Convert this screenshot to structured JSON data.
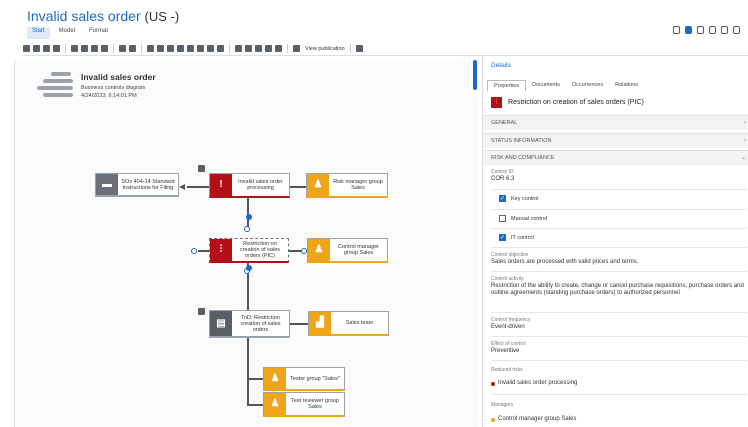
{
  "window": {
    "title": "Invalid sales order",
    "title_suffix": "(US -)",
    "tabs": [
      "Start",
      "Model",
      "Format"
    ]
  },
  "toolbar": {
    "view_publication_label": "View publication"
  },
  "diagram": {
    "header": {
      "title": "Invalid sales order",
      "subtitle": "Business controls diagram",
      "date": "4/24/2023, 6:14:01 PM"
    },
    "nodes": {
      "sox": "SOx 404-14 Standard Instructions for Filing",
      "invalid_order": "Invalid sales order processing",
      "risk_manager": "Risk manager group Sales",
      "restriction": "Restriction on creation of sales orders (PIC)",
      "control_manager": "Control manager group Sales",
      "todo": "ToD: Restriction creation of sales orders",
      "sales_team": "Sales team",
      "tester": "Tester group \"Sales\"",
      "test_reviewer": "Test reviewer group Sales"
    }
  },
  "details": {
    "title": "Details",
    "tabs": [
      "Properties",
      "Documents",
      "Occurrences",
      "Relations"
    ],
    "object_name": "Restriction on creation of sales orders (PIC)",
    "sections": {
      "general": "GENERAL",
      "status": "STATUS INFORMATION",
      "risk": "RISK AND COMPLIANCE"
    },
    "control_id_label": "Control ID",
    "control_id_value": "COR 6.3",
    "checkboxes": {
      "key_control": "Key control",
      "manual_control": "Manual control",
      "it_control": "IT control"
    },
    "objective_label": "Control objective",
    "objective_value": "Sales orders are processed with valid prices and terms.",
    "activity_label": "Control activity",
    "activity_value": "Restriction of the ability to create, change or cancel purchase requisitions, purchase orders and outline agreements (standing purchase orders) to authorized personnel",
    "frequency_label": "Control frequency",
    "frequency_value": "Event-driven",
    "effect_label": "Effect of control",
    "effect_value": "Preventive",
    "reduced_risks_label": "Reduced risks",
    "reduced_risk_item": "Invalid sales order processing",
    "managers_label": "Managers",
    "manager_item": "Control manager group Sales"
  }
}
